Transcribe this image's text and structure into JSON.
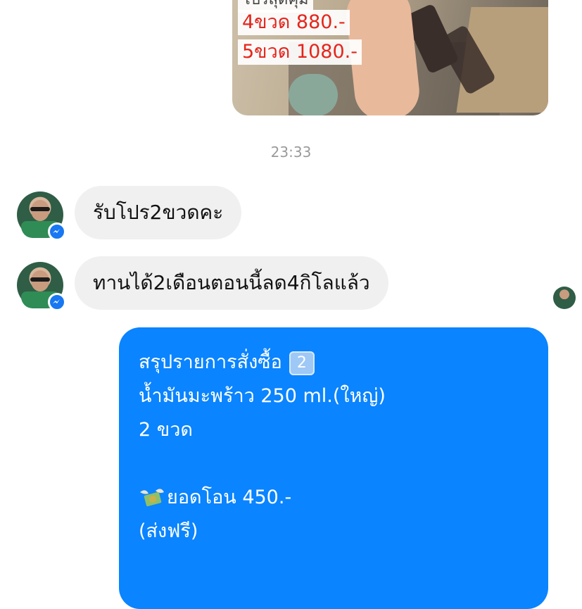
{
  "image_message": {
    "price_lines": [
      "โปรสุดคุ้ม",
      "4ขวด 880.-",
      "5ขวด 1080.-"
    ]
  },
  "timestamp": "23:33",
  "incoming": [
    {
      "text": "รับโปร2ขวดคะ"
    },
    {
      "text": "ทานได้2เดือนตอนนี้ลด4กิโลแล้ว"
    }
  ],
  "outgoing": {
    "title": "สรุปรายการสั่งซื้อ",
    "title_badge": "2",
    "product": "น้ำมันมะพร้าว 250 ml.(ใหญ่)",
    "qty": "2 ขวด",
    "transfer_icon": "money-with-wings-icon",
    "transfer": "ยอดโอน 450.-",
    "shipping": "(ส่งฟรี)"
  },
  "colors": {
    "outgoing_bubble": "#0a84ff",
    "incoming_bubble": "#f0f0f0",
    "messenger_badge": "#1877f2",
    "price_red": "#e5251c"
  }
}
